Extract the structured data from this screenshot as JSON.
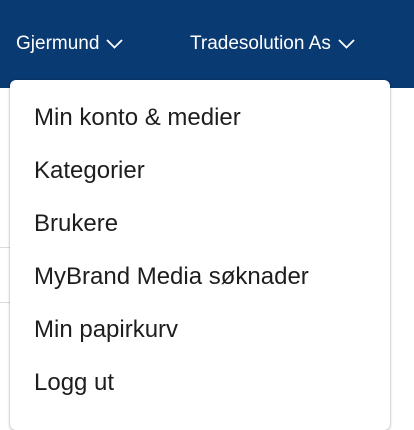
{
  "header": {
    "user_label": "Gjermund",
    "org_label": "Tradesolution As",
    "background_color": "#0a3a72",
    "text_color": "#ffffff"
  },
  "dropdown": {
    "items": [
      {
        "label": "Min konto & medier"
      },
      {
        "label": "Kategorier"
      },
      {
        "label": "Brukere"
      },
      {
        "label": "MyBrand Media søknader"
      },
      {
        "label": "Min papirkurv"
      },
      {
        "label": "Logg ut"
      }
    ],
    "text_color": "#1d1d1d"
  },
  "icons": {
    "user_menu_chevron": "chevron-down-icon",
    "org_menu_chevron": "chevron-down-icon"
  }
}
